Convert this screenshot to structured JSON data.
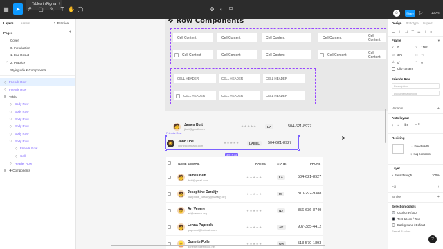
{
  "toolbar": {
    "file_tab": "Tables in Figma",
    "share_label": "Share",
    "zoom": "100%",
    "avatar_initial": "☺"
  },
  "left_panel": {
    "tabs": [
      "Layers",
      "Assets"
    ],
    "current_page": "2. Practice",
    "pages_title": "Pages",
    "pages": [
      "Cover",
      "0. Introduction",
      "1. End Result",
      "2. Practice",
      "Styleguide & Components"
    ],
    "layers": [
      {
        "label": "Friends Row",
        "icon": "◇",
        "indent": 0,
        "selected": true
      },
      {
        "label": "Friends Row",
        "icon": "◇",
        "indent": 0,
        "selected": false
      },
      {
        "label": "Table",
        "icon": "⊞",
        "indent": 0,
        "selected": false
      },
      {
        "label": "Body Row",
        "icon": "◇",
        "indent": 1,
        "selected": false
      },
      {
        "label": "Body Row",
        "icon": "◇",
        "indent": 1,
        "selected": false
      },
      {
        "label": "Body Row",
        "icon": "◇",
        "indent": 1,
        "selected": false
      },
      {
        "label": "Body Row",
        "icon": "◇",
        "indent": 1,
        "selected": false
      },
      {
        "label": "Body Row",
        "icon": "◇",
        "indent": 1,
        "selected": false
      },
      {
        "label": "Body Row",
        "icon": "◇",
        "indent": 1,
        "selected": false
      },
      {
        "label": "Friends Row",
        "icon": "◇",
        "indent": 2,
        "selected": false
      },
      {
        "label": "Cell",
        "icon": "◇",
        "indent": 2,
        "selected": false
      },
      {
        "label": "Header Row",
        "icon": "◇",
        "indent": 1,
        "selected": false
      },
      {
        "label": "❖ Components",
        "icon": "⊞",
        "indent": 0,
        "selected": false
      }
    ]
  },
  "canvas": {
    "frame_title": "❖ Row Components",
    "cell_content": "Cell Content",
    "cell_header": "CELL HEADER",
    "friends_row_label": "Friends Row",
    "size_badge": "376 × 33",
    "floating_rows": [
      {
        "name": "James Butt",
        "email": "jbutt@gmail.com",
        "state": "LA",
        "phone": "504-621-8927",
        "avatar": "🧑"
      },
      {
        "name": "John Doe",
        "email": "john@company.com",
        "state": "LABEL",
        "phone": "504-621-8927",
        "avatar": "🧔"
      }
    ],
    "table": {
      "headers": {
        "name": "NAME & EMAIL",
        "rating": "RATING",
        "state": "STATE",
        "phone": "PHONE"
      },
      "rows": [
        {
          "name": "James Butt",
          "email": "jbutt@gmail.com",
          "state": "LA",
          "phone": "504-621-8927",
          "avatar": "🧑"
        },
        {
          "name": "Josephine Darakjy",
          "email": "josephine_darakjy@darakjy.org",
          "state": "MI",
          "phone": "810-292-9388",
          "avatar": "👩"
        },
        {
          "name": "Art Venere",
          "email": "art@venere.org",
          "state": "NJ",
          "phone": "856-636-8749",
          "avatar": "👨"
        },
        {
          "name": "Lenna Paprocki",
          "email": "lpaprocki@hotmail.com",
          "state": "AK",
          "phone": "907-385-4412",
          "avatar": "👩"
        },
        {
          "name": "Donette Foller",
          "email": "donette.foller@cox.net",
          "state": "OH",
          "phone": "513-570-1893",
          "avatar": "👱"
        }
      ]
    }
  },
  "right_panel": {
    "tabs": [
      "Design",
      "Prototype",
      "Inspect"
    ],
    "frame_title": "Frame",
    "x": "0",
    "y": "1162",
    "w": "376",
    "h": "73",
    "rotation": "0°",
    "radius": "0",
    "clip_content": "Clip content",
    "component_title": "Friends Row",
    "description_placeholder": "Description",
    "documentation_placeholder": "Documentation link",
    "variants_title": "Variants",
    "auto_layout_title": "Auto layout",
    "auto_gap": "8",
    "auto_padding": "0",
    "resizing_title": "Resizing",
    "fixed_width": "Fixed width",
    "hug_contents": "Hug contents",
    "layer_title": "Layer",
    "blend_mode": "Pass through",
    "opacity": "100%",
    "fill_title": "Fill",
    "stroke_title": "Stroke",
    "selection_colors_title": "Selection colors",
    "colors": [
      {
        "label": "Cool Gray/300",
        "hex": "#d1d5db"
      },
      {
        "label": "Text & Icon / Text",
        "hex": "#111827"
      },
      {
        "label": "Background / Default",
        "hex": "#ffffff"
      }
    ],
    "see_all": "See all 8 colors"
  }
}
